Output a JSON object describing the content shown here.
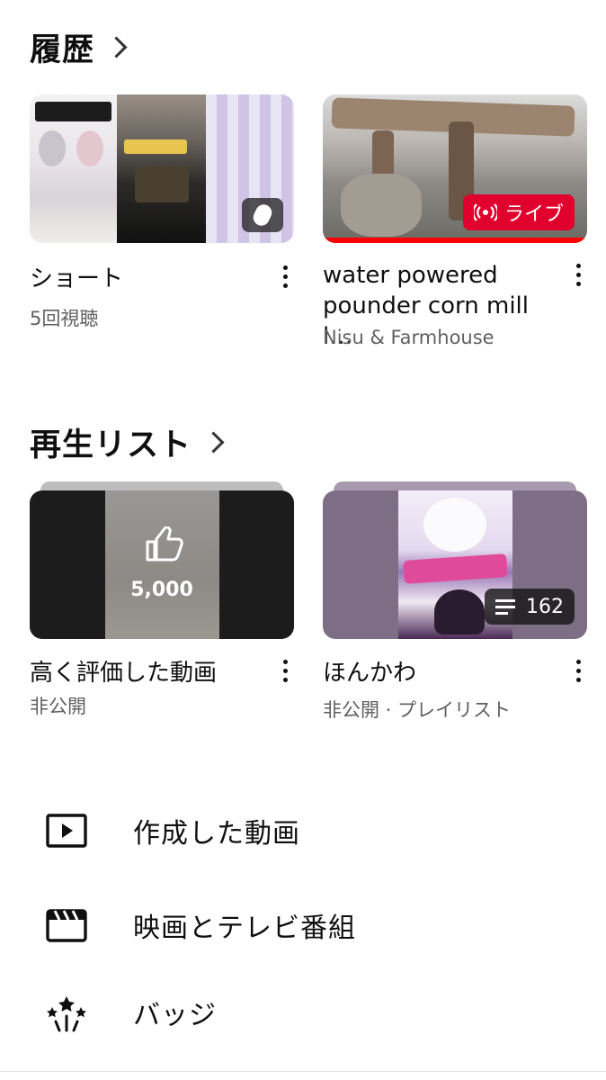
{
  "history": {
    "title": "履歴",
    "cards": [
      {
        "title": "ショート",
        "subtitle": "5回視聴"
      },
      {
        "title": "water powered pounder corn mill l…",
        "subtitle": "Nisu & Farmhouse",
        "badge": "ライブ"
      }
    ]
  },
  "playlists": {
    "title": "再生リスト",
    "cards": [
      {
        "title": "高く評価した動画",
        "subtitle": "非公開",
        "overlay_count": "5,000"
      },
      {
        "title": "ほんかわ",
        "subtitle": "非公開 · プレイリスト",
        "video_count": "162"
      }
    ]
  },
  "menu": [
    {
      "label": "作成した動画",
      "icon": "play-box-icon"
    },
    {
      "label": "映画とテレビ番組",
      "icon": "clapperboard-icon"
    },
    {
      "label": "バッジ",
      "icon": "badge-sparkle-icon"
    }
  ],
  "colors": {
    "live_red": "#e1002d",
    "progress_red": "#ff0000",
    "secondary_text": "#606060"
  }
}
